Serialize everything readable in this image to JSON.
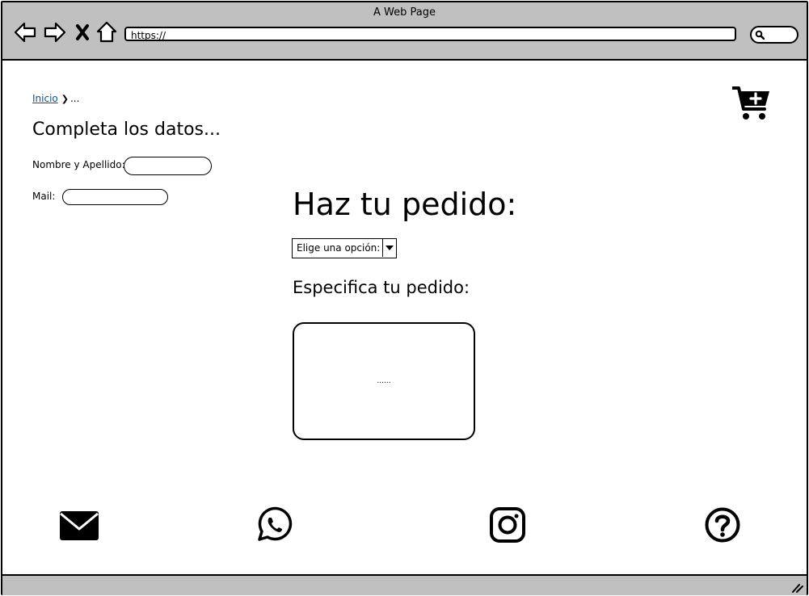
{
  "window": {
    "title": "A Web Page"
  },
  "browser": {
    "url": "https://",
    "nav_icons": [
      "back-arrow-icon",
      "forward-arrow-icon",
      "close-icon",
      "home-icon"
    ],
    "search_icon": "search-icon"
  },
  "breadcrumb": {
    "home_label": "Inicio",
    "separator": "❯",
    "current": "..."
  },
  "cart": {
    "icon": "add-to-cart-icon"
  },
  "form": {
    "title": "Completa los datos...",
    "name_label": "Nombre y Apellido:",
    "name_value": "",
    "mail_label": "Mail:",
    "mail_value": ""
  },
  "order": {
    "title": "Haz tu pedido:",
    "select_value": "Elige una opción:",
    "spec_title": "Especifica tu pedido:",
    "textarea_text": "......"
  },
  "footer": {
    "icons": [
      "mail-icon",
      "whatsapp-icon",
      "instagram-icon",
      "help-icon"
    ]
  }
}
